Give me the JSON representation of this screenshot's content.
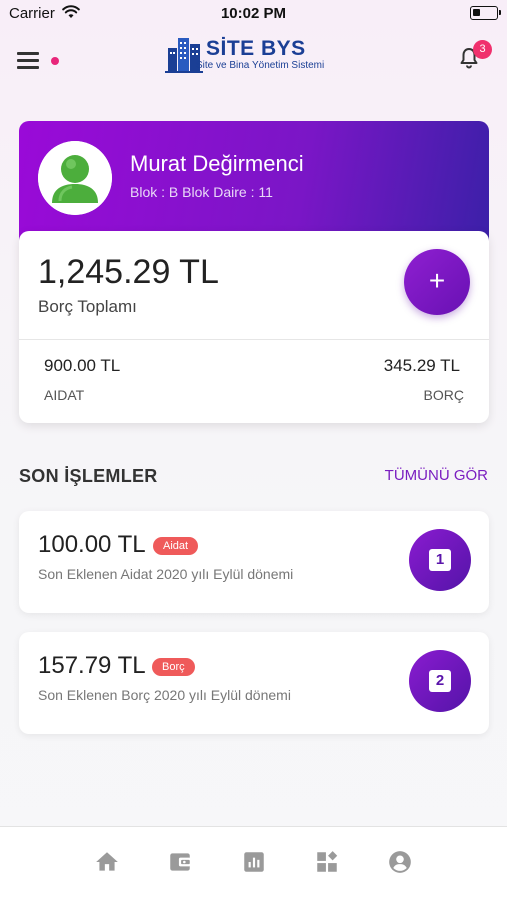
{
  "status_bar": {
    "carrier": "Carrier",
    "time": "10:02 PM",
    "wifi_icon": "wifi-icon",
    "battery_icon": "battery-icon"
  },
  "header": {
    "menu_icon": "hamburger-menu-icon",
    "logo": {
      "title": "SİTE BYS",
      "subtitle": "Site ve Bina Yönetim Sistemi"
    },
    "notifications_icon": "bell-icon",
    "notification_count": "3"
  },
  "profile": {
    "name": "Murat Değirmenci",
    "info": "Blok : B Blok Daire : 11",
    "avatar_icon": "user-avatar-icon"
  },
  "balance": {
    "total_amount": "1,245.29 TL",
    "total_label": "Borç Toplamı",
    "add_label": "+",
    "aidat_amount": "900.00 TL",
    "aidat_label": "AIDAT",
    "borc_amount": "345.29 TL",
    "borc_label": "BORÇ"
  },
  "recent": {
    "title": "SON İŞLEMLER",
    "see_all": "TÜMÜNÜ GÖR",
    "items": [
      {
        "amount": "100.00 TL",
        "badge": "Aidat",
        "description": "Son Eklenen Aidat 2020 yılı Eylül dönemi",
        "number": "1"
      },
      {
        "amount": "157.79 TL",
        "badge": "Borç",
        "description": "Son Eklenen Borç 2020 yılı Eylül dönemi",
        "number": "2"
      }
    ]
  },
  "tab_bar": {
    "tabs": [
      "home-icon",
      "wallet-icon",
      "chart-icon",
      "dashboard-icon",
      "account-icon"
    ]
  },
  "colors": {
    "accent": "#7a16c6",
    "badge": "#ef5a5a",
    "notification": "#f0306d"
  }
}
